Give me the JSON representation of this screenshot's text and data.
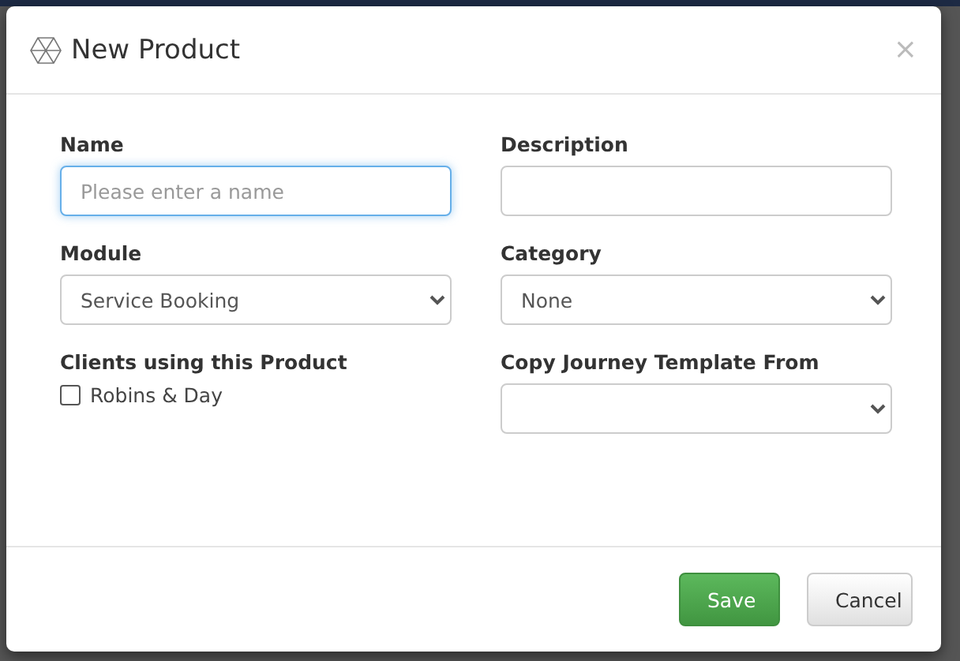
{
  "dialog": {
    "title": "New Product",
    "close": "×"
  },
  "fields": [
    {
      "kind": "text",
      "label": "Name",
      "placeholder": "Please enter a name",
      "focused": true
    },
    {
      "kind": "text",
      "label": "Description",
      "focused": false
    },
    {
      "kind": "select",
      "label": "Module",
      "value": "Service Booking"
    },
    {
      "kind": "select",
      "label": "Category",
      "value": "None"
    },
    {
      "kind": "checklist",
      "label": "Clients using this Product",
      "options": [
        {
          "label": "Robins & Day",
          "checked": false
        }
      ]
    },
    {
      "kind": "select",
      "label": "Copy Journey Template From"
    }
  ],
  "buttons": [
    {
      "label": "Save",
      "kind": "primary"
    },
    {
      "label": "Cancel",
      "kind": "default"
    }
  ]
}
